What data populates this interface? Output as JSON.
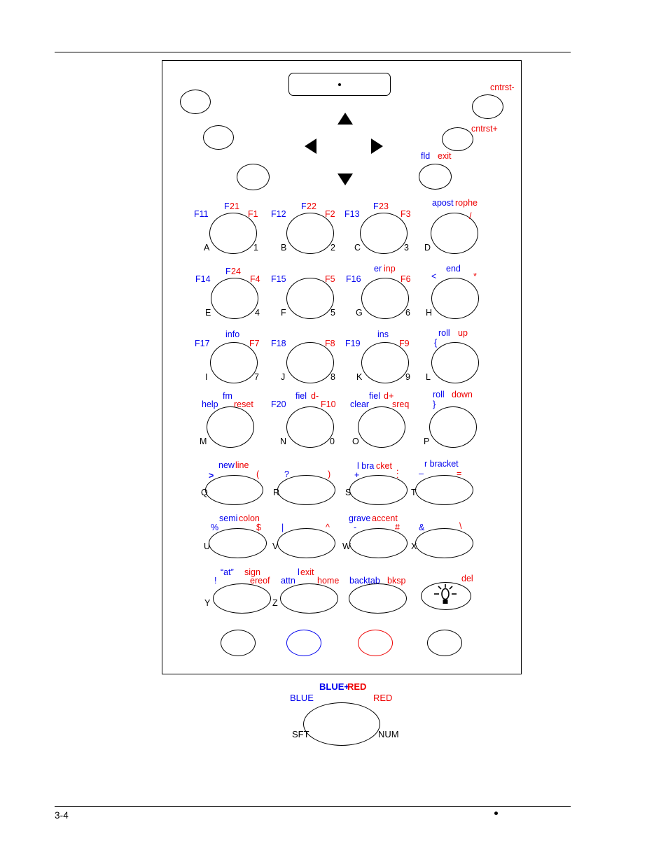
{
  "page": {
    "folio": "3-4",
    "footer_mark": "•"
  },
  "display": {
    "name": "lcd-display",
    "indicator": "•"
  },
  "nav_arrows": {
    "up": "▲",
    "down": "▼",
    "left": "◀",
    "right": "▶"
  },
  "top_keys": [
    {
      "id": "top-left-1",
      "labels": []
    },
    {
      "id": "top-left-2",
      "labels": []
    },
    {
      "id": "top-left-3",
      "labels": []
    },
    {
      "id": "cntrst-minus",
      "labels": [
        {
          "text": "cntrst-",
          "color": "red",
          "pos": "top-right"
        }
      ]
    },
    {
      "id": "cntrst-plus",
      "labels": [
        {
          "text": "cntrst+",
          "color": "red",
          "pos": "right"
        }
      ]
    },
    {
      "id": "fld-exit",
      "labels": [
        {
          "text": "fld",
          "color": "blue",
          "pos": "left"
        },
        {
          "text": "exit",
          "color": "red",
          "pos": "right"
        }
      ]
    }
  ],
  "keys": [
    {
      "id": "key-a",
      "num": "1",
      "alpha": "A",
      "blue": "F11",
      "red": "F1",
      "top_blue": "F",
      "top_red": "21"
    },
    {
      "id": "key-b",
      "num": "2",
      "alpha": "B",
      "blue": "F12",
      "red": "F2",
      "top_blue": "F",
      "top_red": "22"
    },
    {
      "id": "key-c",
      "num": "3",
      "alpha": "C",
      "blue": "F13",
      "red": "F3",
      "top_blue": "F",
      "top_red": "23"
    },
    {
      "id": "key-d",
      "num": "",
      "alpha": "D",
      "blue": "",
      "red": "/",
      "top_blue": "apost",
      "top_red": "rophe"
    },
    {
      "id": "key-e",
      "num": "4",
      "alpha": "E",
      "blue": "F14",
      "red": "F4",
      "top_blue": "F",
      "top_red": "24"
    },
    {
      "id": "key-f",
      "num": "5",
      "alpha": "F",
      "blue": "F15",
      "red": "F5",
      "top_blue": "",
      "top_red": ""
    },
    {
      "id": "key-g",
      "num": "6",
      "alpha": "G",
      "blue": "F16",
      "red": "F6",
      "top_blue": "er",
      "top_red": "inp"
    },
    {
      "id": "key-h",
      "num": "",
      "alpha": "H",
      "blue": "<",
      "red": "*",
      "top_blue": "end",
      "top_red": ""
    },
    {
      "id": "key-i",
      "num": "7",
      "alpha": "I",
      "blue": "F17",
      "red": "F7",
      "top_blue": "info",
      "top_red": ""
    },
    {
      "id": "key-j",
      "num": "8",
      "alpha": "J",
      "blue": "F18",
      "red": "F8",
      "top_blue": "",
      "top_red": ""
    },
    {
      "id": "key-k",
      "num": "9",
      "alpha": "K",
      "blue": "F19",
      "red": "F9",
      "top_blue": "ins",
      "top_red": ""
    },
    {
      "id": "key-l",
      "num": "",
      "alpha": "L",
      "blue": "{",
      "red": "",
      "top_blue": "roll ",
      "top_red": "up"
    },
    {
      "id": "key-m",
      "num": "",
      "alpha": "M",
      "blue": "help",
      "red": "reset",
      "top_blue": "fm",
      "top_red": ""
    },
    {
      "id": "key-n",
      "num": "0",
      "alpha": "N",
      "blue": "F20",
      "red": "F10",
      "top_blue": "fiel",
      "top_red": "d-"
    },
    {
      "id": "key-o",
      "num": "",
      "alpha": "O",
      "blue": "clear",
      "red": "sreq",
      "top_blue": "fiel",
      "top_red": "d+"
    },
    {
      "id": "key-p",
      "num": "",
      "alpha": "P",
      "blue": "}",
      "red": "",
      "top_blue": "roll ",
      "top_red": "down"
    },
    {
      "id": "key-q",
      "num": "",
      "alpha": "Q",
      "blue": ">",
      "red": "(",
      "top_blue": "new",
      "top_red": "line"
    },
    {
      "id": "key-r",
      "num": "",
      "alpha": "R",
      "blue": "?",
      "red": ")",
      "top_blue": "",
      "top_red": ""
    },
    {
      "id": "key-s",
      "num": "",
      "alpha": "S",
      "blue": "+",
      "red": ":",
      "top_blue": "l bra",
      "top_red": "cket",
      "extra_red": "."
    },
    {
      "id": "key-t",
      "num": "",
      "alpha": "T",
      "blue": "–",
      "red": "=",
      "top_blue": "r bracket",
      "top_red": ""
    },
    {
      "id": "key-u",
      "num": "",
      "alpha": "U",
      "blue": "%",
      "red": "$",
      "top_blue": "semi",
      "top_red": "colon"
    },
    {
      "id": "key-v",
      "num": "",
      "alpha": "V",
      "blue": "|",
      "red": "^",
      "top_blue": "",
      "top_red": ""
    },
    {
      "id": "key-w",
      "num": "",
      "alpha": "W",
      "blue": "-",
      "red": "#",
      "top_blue": "grave",
      "top_red": "accent"
    },
    {
      "id": "key-x",
      "num": "",
      "alpha": "X",
      "blue": "&",
      "red": "\\",
      "top_blue": "",
      "top_red": ""
    },
    {
      "id": "key-y",
      "num": "",
      "alpha": "Y",
      "blue": "!",
      "red": "ereof",
      "top_blue": "“at” ",
      "top_red": "sign"
    },
    {
      "id": "key-z",
      "num": "",
      "alpha": "Z",
      "blue": "attn",
      "red": "home",
      "top_blue": "l",
      "top_red": "exit"
    },
    {
      "id": "key-backtab",
      "num": "",
      "alpha": "",
      "blue": "backtab",
      "red": "bksp",
      "top_blue": "",
      "top_red": ""
    },
    {
      "id": "key-lamp",
      "num": "",
      "alpha": "",
      "blue": "",
      "red": "del",
      "top_blue": "",
      "top_red": "",
      "icon": "lamp-icon"
    }
  ],
  "bottom_keys": [
    {
      "id": "shift-key",
      "ring": "black"
    },
    {
      "id": "blue-function-key",
      "ring": "blue"
    },
    {
      "id": "red-function-key",
      "ring": "red"
    },
    {
      "id": "num-key",
      "ring": "black"
    }
  ],
  "legend": {
    "title_blue": "BLUE+",
    "title_red": "RED",
    "left": "BLUE",
    "right": "RED",
    "bottom_left": "SFT",
    "bottom_right": "NUM"
  },
  "colors": {
    "blue": "#0000ee",
    "red": "#ee0000",
    "black": "#000000"
  }
}
